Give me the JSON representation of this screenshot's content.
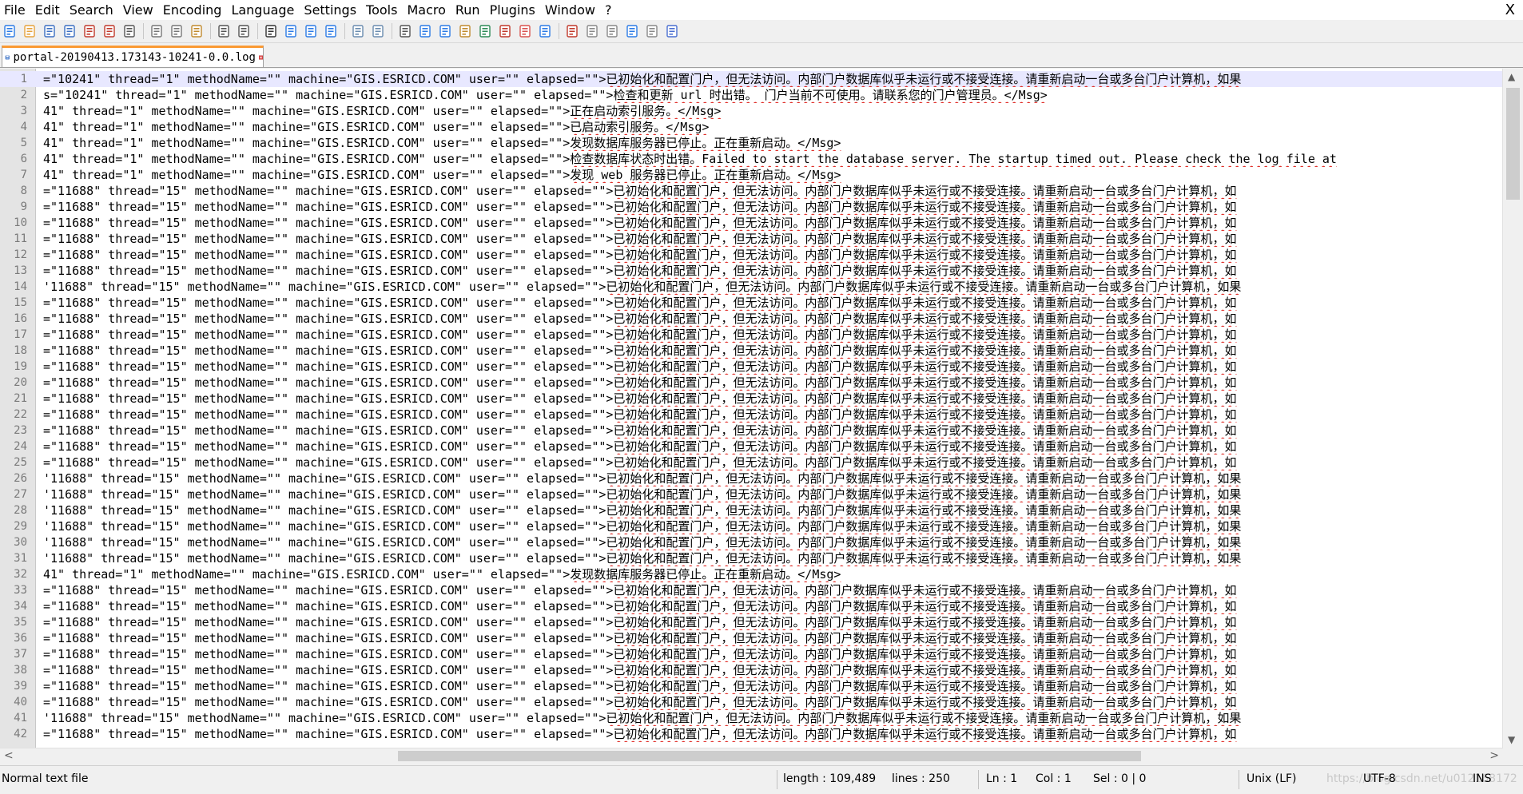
{
  "menu": {
    "items": [
      "File",
      "Edit",
      "Search",
      "View",
      "Encoding",
      "Language",
      "Settings",
      "Tools",
      "Macro",
      "Run",
      "Plugins",
      "Window",
      "?"
    ],
    "close": "X"
  },
  "toolbar": {
    "icons": [
      "new-file-icon",
      "open-file-icon",
      "save-icon",
      "save-all-icon",
      "close-icon",
      "close-all-icon",
      "print-icon",
      "cut-icon",
      "copy-icon",
      "paste-icon",
      "undo-icon",
      "redo-icon",
      "find-icon",
      "replace-icon",
      "zoom-in-icon",
      "zoom-out-icon",
      "sync-vertical-icon",
      "sync-horizontal-icon",
      "word-wrap-icon",
      "show-all-characters-icon",
      "indent-guide-icon",
      "user-language-icon",
      "document-map-icon",
      "function-list-icon",
      "folder-as-workspace-icon",
      "monitoring-icon",
      "record-macro-icon",
      "stop-recording-icon",
      "play-macro-icon",
      "run-macro-multiple-icon",
      "save-macro-icon",
      "spell-check-icon"
    ]
  },
  "tab": {
    "label": "portal-20190413.173143-10241-0.0.log"
  },
  "editor": {
    "lines": [
      {
        "n": "1",
        "pre": "=\"10241\" thread=\"1\" methodName=\"\" machine=\"GIS.ESRICD.COM\" user=\"\" elapsed=\"\">",
        "cjk": "已初始化和配置门户，但无法访问。内部门户数据库似乎未运行或不接受连接。请重新启动一台或多台门户计算机，如果"
      },
      {
        "n": "2",
        "pre": "s=\"10241\" thread=\"1\" methodName=\"\" machine=\"GIS.ESRICD.COM\" user=\"\" elapsed=\"\">",
        "cjk": "检查和更新 url 时出错。 门户当前不可使用。请联系您的门户管理员。</Msg>"
      },
      {
        "n": "3",
        "pre": "41\" thread=\"1\" methodName=\"\" machine=\"GIS.ESRICD.COM\" user=\"\" elapsed=\"\">",
        "cjk": "正在启动索引服务。</Msg>"
      },
      {
        "n": "4",
        "pre": "41\" thread=\"1\" methodName=\"\" machine=\"GIS.ESRICD.COM\" user=\"\" elapsed=\"\">",
        "cjk": "已启动索引服务。</Msg>"
      },
      {
        "n": "5",
        "pre": "41\" thread=\"1\" methodName=\"\" machine=\"GIS.ESRICD.COM\" user=\"\" elapsed=\"\">",
        "cjk": "发现数据库服务器已停止。正在重新启动。</Msg>"
      },
      {
        "n": "6",
        "pre": "41\" thread=\"1\" methodName=\"\" machine=\"GIS.ESRICD.COM\" user=\"\" elapsed=\"\">",
        "cjk": "检查数据库状态时出错。Failed to start the database server. The startup timed out. Please check the log file at"
      },
      {
        "n": "7",
        "pre": "41\" thread=\"1\" methodName=\"\" machine=\"GIS.ESRICD.COM\" user=\"\" elapsed=\"\">",
        "cjk": "发现 web 服务器已停止。正在重新启动。</Msg>"
      },
      {
        "n": "8",
        "pre": "=\"11688\" thread=\"15\" methodName=\"\" machine=\"GIS.ESRICD.COM\" user=\"\" elapsed=\"\">",
        "cjk": "已初始化和配置门户，但无法访问。内部门户数据库似乎未运行或不接受连接。请重新启动一台或多台门户计算机，如"
      },
      {
        "n": "9",
        "pre": "=\"11688\" thread=\"15\" methodName=\"\" machine=\"GIS.ESRICD.COM\" user=\"\" elapsed=\"\">",
        "cjk": "已初始化和配置门户，但无法访问。内部门户数据库似乎未运行或不接受连接。请重新启动一台或多台门户计算机，如"
      },
      {
        "n": "10",
        "pre": "=\"11688\" thread=\"15\" methodName=\"\" machine=\"GIS.ESRICD.COM\" user=\"\" elapsed=\"\">",
        "cjk": "已初始化和配置门户，但无法访问。内部门户数据库似乎未运行或不接受连接。请重新启动一台或多台门户计算机，如"
      },
      {
        "n": "11",
        "pre": "=\"11688\" thread=\"15\" methodName=\"\" machine=\"GIS.ESRICD.COM\" user=\"\" elapsed=\"\">",
        "cjk": "已初始化和配置门户，但无法访问。内部门户数据库似乎未运行或不接受连接。请重新启动一台或多台门户计算机，如"
      },
      {
        "n": "12",
        "pre": "=\"11688\" thread=\"15\" methodName=\"\" machine=\"GIS.ESRICD.COM\" user=\"\" elapsed=\"\">",
        "cjk": "已初始化和配置门户，但无法访问。内部门户数据库似乎未运行或不接受连接。请重新启动一台或多台门户计算机，如"
      },
      {
        "n": "13",
        "pre": "=\"11688\" thread=\"15\" methodName=\"\" machine=\"GIS.ESRICD.COM\" user=\"\" elapsed=\"\">",
        "cjk": "已初始化和配置门户，但无法访问。内部门户数据库似乎未运行或不接受连接。请重新启动一台或多台门户计算机，如"
      },
      {
        "n": "14",
        "pre": "'11688\" thread=\"15\" methodName=\"\" machine=\"GIS.ESRICD.COM\" user=\"\" elapsed=\"\">",
        "cjk": "已初始化和配置门户，但无法访问。内部门户数据库似乎未运行或不接受连接。请重新启动一台或多台门户计算机，如果"
      },
      {
        "n": "15",
        "pre": "=\"11688\" thread=\"15\" methodName=\"\" machine=\"GIS.ESRICD.COM\" user=\"\" elapsed=\"\">",
        "cjk": "已初始化和配置门户，但无法访问。内部门户数据库似乎未运行或不接受连接。请重新启动一台或多台门户计算机，如"
      },
      {
        "n": "16",
        "pre": "=\"11688\" thread=\"15\" methodName=\"\" machine=\"GIS.ESRICD.COM\" user=\"\" elapsed=\"\">",
        "cjk": "已初始化和配置门户，但无法访问。内部门户数据库似乎未运行或不接受连接。请重新启动一台或多台门户计算机，如"
      },
      {
        "n": "17",
        "pre": "=\"11688\" thread=\"15\" methodName=\"\" machine=\"GIS.ESRICD.COM\" user=\"\" elapsed=\"\">",
        "cjk": "已初始化和配置门户，但无法访问。内部门户数据库似乎未运行或不接受连接。请重新启动一台或多台门户计算机，如"
      },
      {
        "n": "18",
        "pre": "=\"11688\" thread=\"15\" methodName=\"\" machine=\"GIS.ESRICD.COM\" user=\"\" elapsed=\"\">",
        "cjk": "已初始化和配置门户，但无法访问。内部门户数据库似乎未运行或不接受连接。请重新启动一台或多台门户计算机，如"
      },
      {
        "n": "19",
        "pre": "=\"11688\" thread=\"15\" methodName=\"\" machine=\"GIS.ESRICD.COM\" user=\"\" elapsed=\"\">",
        "cjk": "已初始化和配置门户，但无法访问。内部门户数据库似乎未运行或不接受连接。请重新启动一台或多台门户计算机，如"
      },
      {
        "n": "20",
        "pre": "=\"11688\" thread=\"15\" methodName=\"\" machine=\"GIS.ESRICD.COM\" user=\"\" elapsed=\"\">",
        "cjk": "已初始化和配置门户，但无法访问。内部门户数据库似乎未运行或不接受连接。请重新启动一台或多台门户计算机，如"
      },
      {
        "n": "21",
        "pre": "=\"11688\" thread=\"15\" methodName=\"\" machine=\"GIS.ESRICD.COM\" user=\"\" elapsed=\"\">",
        "cjk": "已初始化和配置门户，但无法访问。内部门户数据库似乎未运行或不接受连接。请重新启动一台或多台门户计算机，如"
      },
      {
        "n": "22",
        "pre": "=\"11688\" thread=\"15\" methodName=\"\" machine=\"GIS.ESRICD.COM\" user=\"\" elapsed=\"\">",
        "cjk": "已初始化和配置门户，但无法访问。内部门户数据库似乎未运行或不接受连接。请重新启动一台或多台门户计算机，如"
      },
      {
        "n": "23",
        "pre": "=\"11688\" thread=\"15\" methodName=\"\" machine=\"GIS.ESRICD.COM\" user=\"\" elapsed=\"\">",
        "cjk": "已初始化和配置门户，但无法访问。内部门户数据库似乎未运行或不接受连接。请重新启动一台或多台门户计算机，如"
      },
      {
        "n": "24",
        "pre": "=\"11688\" thread=\"15\" methodName=\"\" machine=\"GIS.ESRICD.COM\" user=\"\" elapsed=\"\">",
        "cjk": "已初始化和配置门户，但无法访问。内部门户数据库似乎未运行或不接受连接。请重新启动一台或多台门户计算机，如"
      },
      {
        "n": "25",
        "pre": "=\"11688\" thread=\"15\" methodName=\"\" machine=\"GIS.ESRICD.COM\" user=\"\" elapsed=\"\">",
        "cjk": "已初始化和配置门户，但无法访问。内部门户数据库似乎未运行或不接受连接。请重新启动一台或多台门户计算机，如"
      },
      {
        "n": "26",
        "pre": "'11688\" thread=\"15\" methodName=\"\" machine=\"GIS.ESRICD.COM\" user=\"\" elapsed=\"\">",
        "cjk": "已初始化和配置门户，但无法访问。内部门户数据库似乎未运行或不接受连接。请重新启动一台或多台门户计算机，如果"
      },
      {
        "n": "27",
        "pre": "'11688\" thread=\"15\" methodName=\"\" machine=\"GIS.ESRICD.COM\" user=\"\" elapsed=\"\">",
        "cjk": "已初始化和配置门户，但无法访问。内部门户数据库似乎未运行或不接受连接。请重新启动一台或多台门户计算机，如果"
      },
      {
        "n": "28",
        "pre": "'11688\" thread=\"15\" methodName=\"\" machine=\"GIS.ESRICD.COM\" user=\"\" elapsed=\"\">",
        "cjk": "已初始化和配置门户，但无法访问。内部门户数据库似乎未运行或不接受连接。请重新启动一台或多台门户计算机，如果"
      },
      {
        "n": "29",
        "pre": "'11688\" thread=\"15\" methodName=\"\" machine=\"GIS.ESRICD.COM\" user=\"\" elapsed=\"\">",
        "cjk": "已初始化和配置门户，但无法访问。内部门户数据库似乎未运行或不接受连接。请重新启动一台或多台门户计算机，如果"
      },
      {
        "n": "30",
        "pre": "'11688\" thread=\"15\" methodName=\"\" machine=\"GIS.ESRICD.COM\" user=\"\" elapsed=\"\">",
        "cjk": "已初始化和配置门户，但无法访问。内部门户数据库似乎未运行或不接受连接。请重新启动一台或多台门户计算机，如果"
      },
      {
        "n": "31",
        "pre": "'11688\" thread=\"15\" methodName=\"\" machine=\"GIS.ESRICD.COM\" user=\"\" elapsed=\"\">",
        "cjk": "已初始化和配置门户，但无法访问。内部门户数据库似乎未运行或不接受连接。请重新启动一台或多台门户计算机，如果"
      },
      {
        "n": "32",
        "pre": "41\" thread=\"1\" methodName=\"\" machine=\"GIS.ESRICD.COM\" user=\"\" elapsed=\"\">",
        "cjk": "发现数据库服务器已停止。正在重新启动。</Msg>"
      },
      {
        "n": "33",
        "pre": "=\"11688\" thread=\"15\" methodName=\"\" machine=\"GIS.ESRICD.COM\" user=\"\" elapsed=\"\">",
        "cjk": "已初始化和配置门户，但无法访问。内部门户数据库似乎未运行或不接受连接。请重新启动一台或多台门户计算机，如"
      },
      {
        "n": "34",
        "pre": "=\"11688\" thread=\"15\" methodName=\"\" machine=\"GIS.ESRICD.COM\" user=\"\" elapsed=\"\">",
        "cjk": "已初始化和配置门户，但无法访问。内部门户数据库似乎未运行或不接受连接。请重新启动一台或多台门户计算机，如"
      },
      {
        "n": "35",
        "pre": "=\"11688\" thread=\"15\" methodName=\"\" machine=\"GIS.ESRICD.COM\" user=\"\" elapsed=\"\">",
        "cjk": "已初始化和配置门户，但无法访问。内部门户数据库似乎未运行或不接受连接。请重新启动一台或多台门户计算机，如"
      },
      {
        "n": "36",
        "pre": "=\"11688\" thread=\"15\" methodName=\"\" machine=\"GIS.ESRICD.COM\" user=\"\" elapsed=\"\">",
        "cjk": "已初始化和配置门户，但无法访问。内部门户数据库似乎未运行或不接受连接。请重新启动一台或多台门户计算机，如"
      },
      {
        "n": "37",
        "pre": "=\"11688\" thread=\"15\" methodName=\"\" machine=\"GIS.ESRICD.COM\" user=\"\" elapsed=\"\">",
        "cjk": "已初始化和配置门户，但无法访问。内部门户数据库似乎未运行或不接受连接。请重新启动一台或多台门户计算机，如"
      },
      {
        "n": "38",
        "pre": "=\"11688\" thread=\"15\" methodName=\"\" machine=\"GIS.ESRICD.COM\" user=\"\" elapsed=\"\">",
        "cjk": "已初始化和配置门户，但无法访问。内部门户数据库似乎未运行或不接受连接。请重新启动一台或多台门户计算机，如"
      },
      {
        "n": "39",
        "pre": "=\"11688\" thread=\"15\" methodName=\"\" machine=\"GIS.ESRICD.COM\" user=\"\" elapsed=\"\">",
        "cjk": "已初始化和配置门户，但无法访问。内部门户数据库似乎未运行或不接受连接。请重新启动一台或多台门户计算机，如"
      },
      {
        "n": "40",
        "pre": "=\"11688\" thread=\"15\" methodName=\"\" machine=\"GIS.ESRICD.COM\" user=\"\" elapsed=\"\">",
        "cjk": "已初始化和配置门户，但无法访问。内部门户数据库似乎未运行或不接受连接。请重新启动一台或多台门户计算机，如"
      },
      {
        "n": "41",
        "pre": "'11688\" thread=\"15\" methodName=\"\" machine=\"GIS.ESRICD.COM\" user=\"\" elapsed=\"\">",
        "cjk": "已初始化和配置门户，但无法访问。内部门户数据库似乎未运行或不接受连接。请重新启动一台或多台门户计算机，如果"
      },
      {
        "n": "42",
        "pre": "=\"11688\" thread=\"15\" methodName=\"\" machine=\"GIS.ESRICD.COM\" user=\"\" elapsed=\"\">",
        "cjk": "已初始化和配置门户，但无法访问。内部门户数据库似乎未运行或不接受连接。请重新启动一台或多台门户计算机，如"
      }
    ]
  },
  "status": {
    "type": "Normal text file",
    "length": "length : 109,489",
    "lines": "lines : 250",
    "ln": "Ln : 1",
    "col": "Col : 1",
    "sel": "Sel : 0 | 0",
    "eol": "Unix (LF)",
    "encoding": "UTF-8",
    "mode": "INS",
    "watermark": "https://blog.csdn.net/u012168172"
  }
}
